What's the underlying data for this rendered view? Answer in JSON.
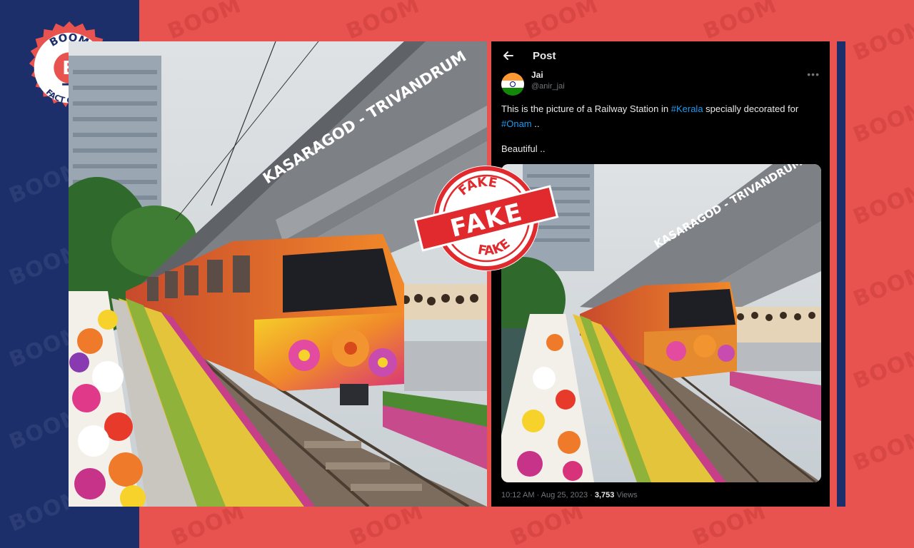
{
  "brand": {
    "logo_letter": "B",
    "logo_top": "BOOM",
    "logo_bottom": "FACT CHECK",
    "watermark": "BOOM"
  },
  "stamp": {
    "top": "FAKE",
    "center": "FAKE",
    "bottom": "FAKE",
    "color": "#e02a2e"
  },
  "image_sign": {
    "text": "KASARAGOD - TRIVANDRUM"
  },
  "tweet": {
    "header_title": "Post",
    "author_name": "Jai",
    "author_handle": "@anir_jai",
    "text_part1": "This is the picture of a Railway Station in ",
    "hashtag1": "#Kerala",
    "text_part2": " specially decorated for ",
    "hashtag2": "#Onam",
    "text_part3": " ..",
    "text_line2": "Beautiful ..",
    "timestamp": "10:12 AM · Aug 25, 2023 · ",
    "views_count": "3,753",
    "views_label": " Views"
  },
  "colors": {
    "background_red": "#e8524f",
    "navy": "#1c2f6b",
    "link_blue": "#1d9bf0"
  }
}
